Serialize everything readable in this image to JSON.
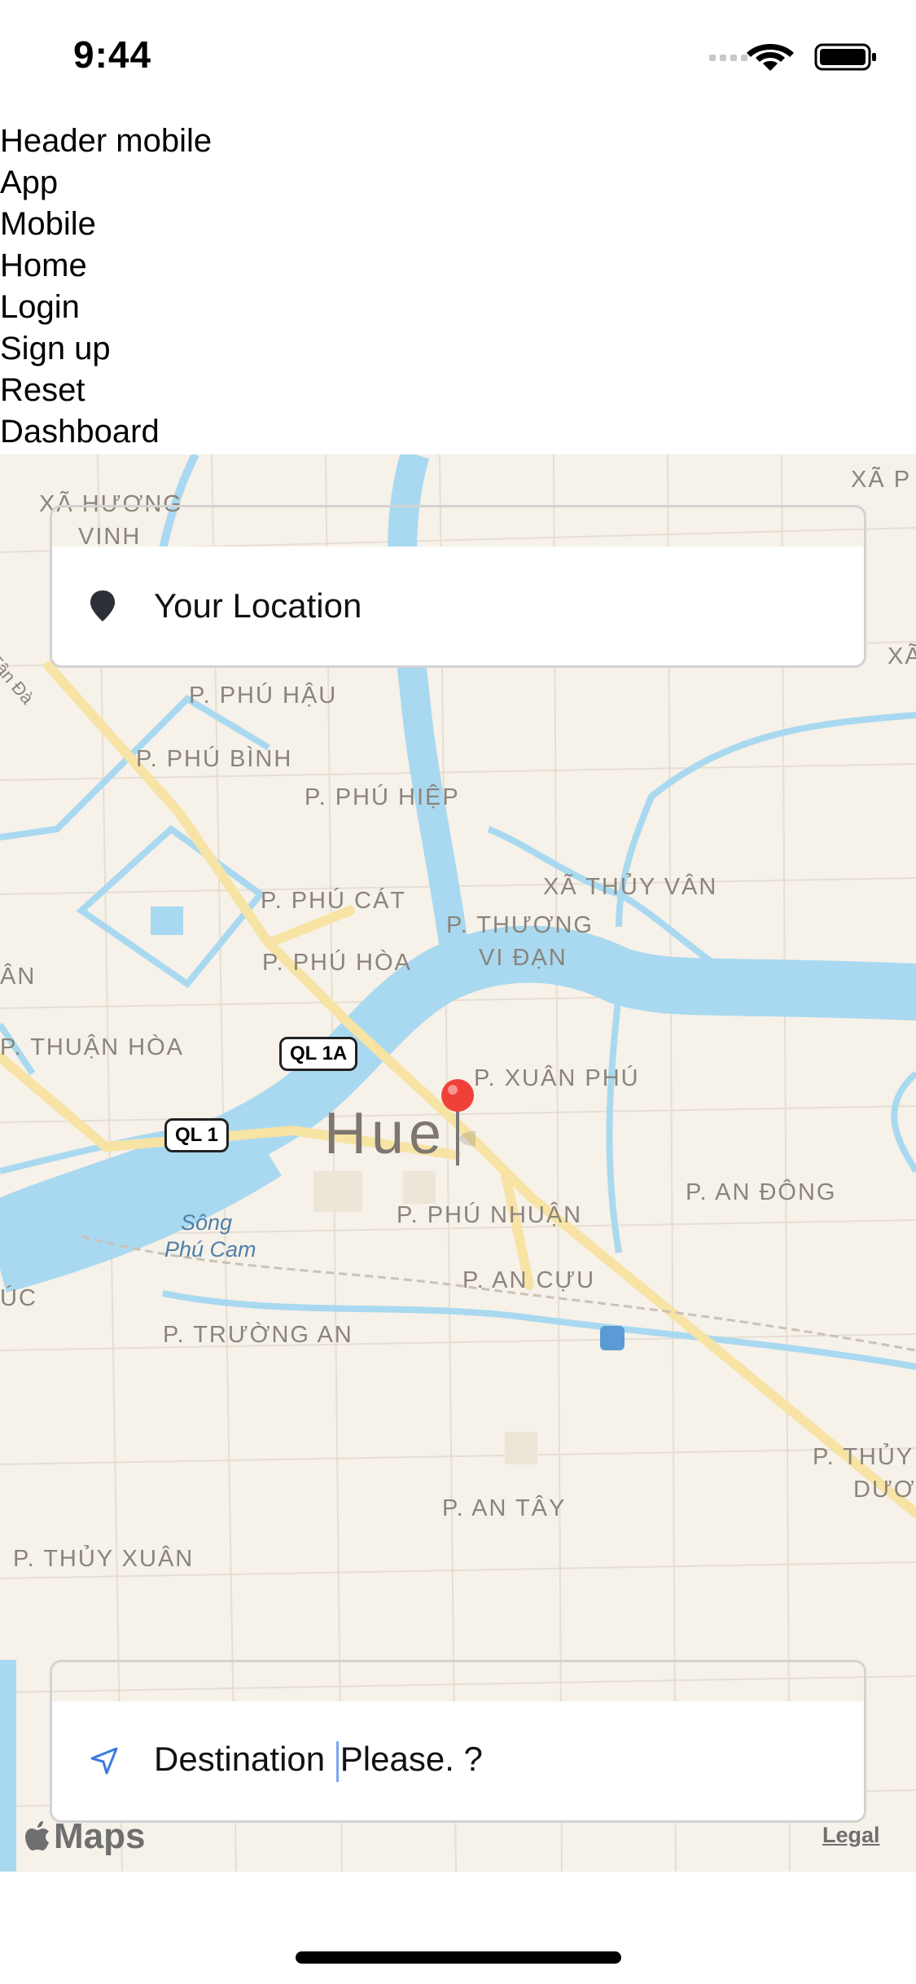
{
  "status_bar": {
    "time": "9:44"
  },
  "nav": {
    "items": [
      "Header mobile",
      "App",
      "Mobile",
      "Home",
      "Login",
      "Sign up",
      "Reset",
      "Dashboard"
    ]
  },
  "map": {
    "city_label": "Hue",
    "district_labels": [
      "XÃ HƯƠNG",
      "VINH",
      "XÃ P",
      "XÃ",
      "P. PHÚ HẬU",
      "P. PHÚ BÌNH",
      "P. PHÚ HIỆP",
      "XÃ THỦY VÂN",
      "P. PHÚ CÁT",
      "P. THƯƠNG",
      "VI ĐẠN",
      "P. PHÚ HÒA",
      "ÂN",
      "P. THUẬN HÒA",
      "P. XUÂN PHÚ",
      "P. AN ĐÔNG",
      "P. PHÚ NHUẬN",
      "ÚC",
      "P. AN CỰU",
      "P. TRƯỜNG AN",
      "P. THỦY",
      "DƯƠNG",
      "P. AN TÂY",
      "P. THỦY XUÂN"
    ],
    "street_label": "Tân Đà",
    "water_label_1": "Sông",
    "water_label_2": "Phú Cam",
    "shield_1": "QL 1A",
    "shield_2": "QL 1",
    "attribution": "Maps",
    "legal": "Legal",
    "colors": {
      "land": "#f6f1e9",
      "water": "#a9d9f0",
      "road": "#f7e3a4",
      "pin": "#f0403a"
    }
  },
  "origin_input": {
    "value": "Your Location",
    "icon": "location-pin-icon"
  },
  "destination_input": {
    "value_before_caret": "Destination ",
    "value_after_caret": "Please. ?",
    "icon": "navigation-arrow-icon"
  }
}
